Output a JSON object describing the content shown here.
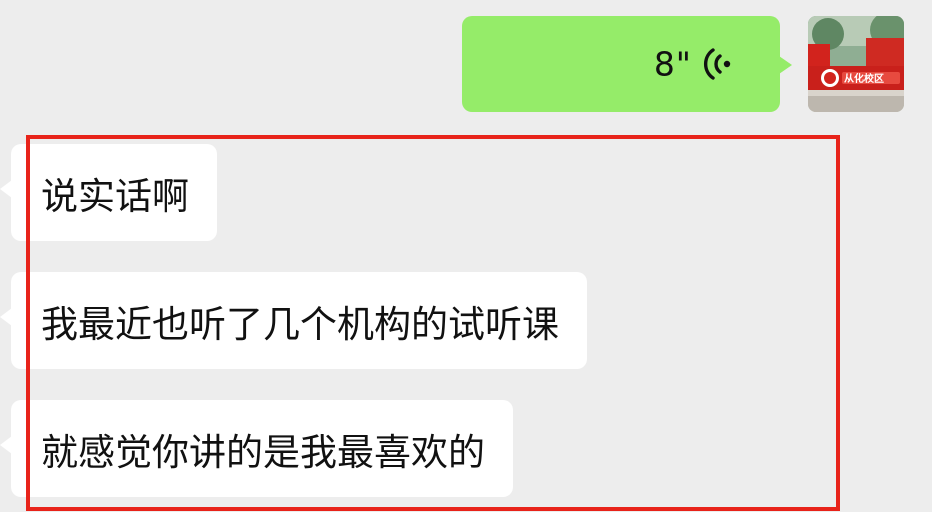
{
  "chat": {
    "outgoing": {
      "voice_duration": "8\"",
      "icon": "voice-wave-icon",
      "bubble_color": "#95ec69",
      "avatar_text": "从化校区"
    },
    "incoming": [
      {
        "text": "说实话啊"
      },
      {
        "text": "我最近也听了几个机构的试听课"
      },
      {
        "text": "就感觉你讲的是我最喜欢的"
      }
    ]
  },
  "colors": {
    "background": "#ededed",
    "incoming_bubble": "#ffffff",
    "highlight": "#e8231a"
  }
}
